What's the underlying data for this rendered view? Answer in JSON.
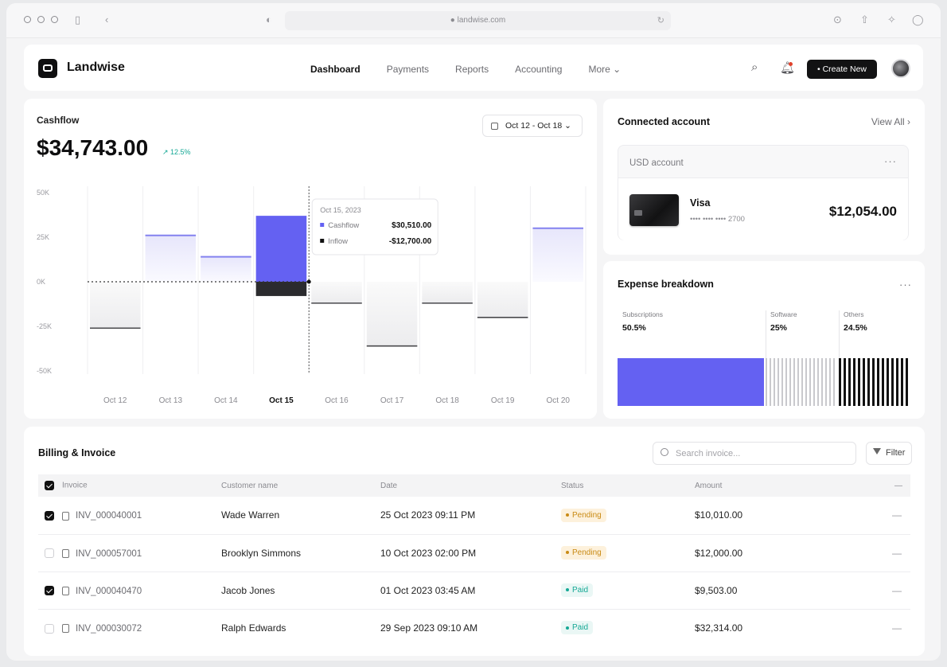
{
  "browser": {
    "url": "● landwise.com"
  },
  "header": {
    "brand": "Landwise",
    "nav": [
      "Dashboard",
      "Payments",
      "Reports",
      "Accounting",
      "More ⌄"
    ],
    "active_nav": "Dashboard",
    "create_label": "• Create New"
  },
  "cashflow": {
    "label": "Cashflow",
    "amount": "$34,743.00",
    "trend": "↗ 12.5%",
    "date_range": "Oct 12 - Oct 18  ⌄",
    "tooltip": {
      "date": "Oct 15, 2023",
      "rows": [
        {
          "label": "Cashflow",
          "value": "$30,510.00"
        },
        {
          "label": "Inflow",
          "value": "-$12,700.00"
        }
      ]
    }
  },
  "chart_data": {
    "type": "bar",
    "title": "",
    "categories": [
      "Oct 12",
      "Oct 13",
      "Oct 14",
      "Oct 15",
      "Oct 16",
      "Oct 17",
      "Oct 18",
      "Oct 19",
      "Oct 20"
    ],
    "highlight_category": "Oct 15",
    "series": [
      {
        "values": [
          -26,
          26,
          14,
          37,
          -12,
          -36,
          -12,
          -20,
          30
        ]
      },
      {
        "values": [
          0,
          0,
          0,
          -8,
          0,
          0,
          0,
          0,
          0
        ]
      }
    ],
    "y_ticks": [
      "50K",
      "25K",
      "0K",
      "-25K",
      "-50K"
    ],
    "ylim": [
      -50,
      50
    ],
    "grid": true,
    "colors": {
      "accent": "#6461f2",
      "negative": "#2b2b2e"
    }
  },
  "connected": {
    "title": "Connected account",
    "view_all": "View All  ›",
    "account_name": "USD account",
    "card_name": "Visa",
    "card_number": "•••• •••• •••• 2700",
    "balance": "$12,054.00"
  },
  "expense": {
    "title": "Expense breakdown",
    "segments": [
      {
        "label": "Subscriptions",
        "pct": "50.5%",
        "fraction": 0.505
      },
      {
        "label": "Software",
        "pct": "25%",
        "fraction": 0.25
      },
      {
        "label": "Others",
        "pct": "24.5%",
        "fraction": 0.245
      }
    ]
  },
  "billing": {
    "title": "Billing & Invoice",
    "search_placeholder": "Search invoice...",
    "filter_label": "Filter",
    "columns": [
      "Invoice",
      "Customer name",
      "Date",
      "Status",
      "Amount",
      "—"
    ],
    "rows": [
      {
        "checked": true,
        "invoice": "INV_000040001",
        "customer": "Wade Warren",
        "date": "25 Oct 2023 09:11 PM",
        "status": "Pending",
        "amount": "$10,010.00"
      },
      {
        "checked": false,
        "invoice": "INV_000057001",
        "customer": "Brooklyn Simmons",
        "date": "10 Oct 2023 02:00 PM",
        "status": "Pending",
        "amount": "$12,000.00"
      },
      {
        "checked": true,
        "invoice": "INV_000040470",
        "customer": "Jacob Jones",
        "date": "01 Oct 2023 03:45 AM",
        "status": "Paid",
        "amount": "$9,503.00"
      },
      {
        "checked": false,
        "invoice": "INV_000030072",
        "customer": "Ralph Edwards",
        "date": "29 Sep 2023 09:10 AM",
        "status": "Paid",
        "amount": "$32,314.00"
      }
    ]
  }
}
